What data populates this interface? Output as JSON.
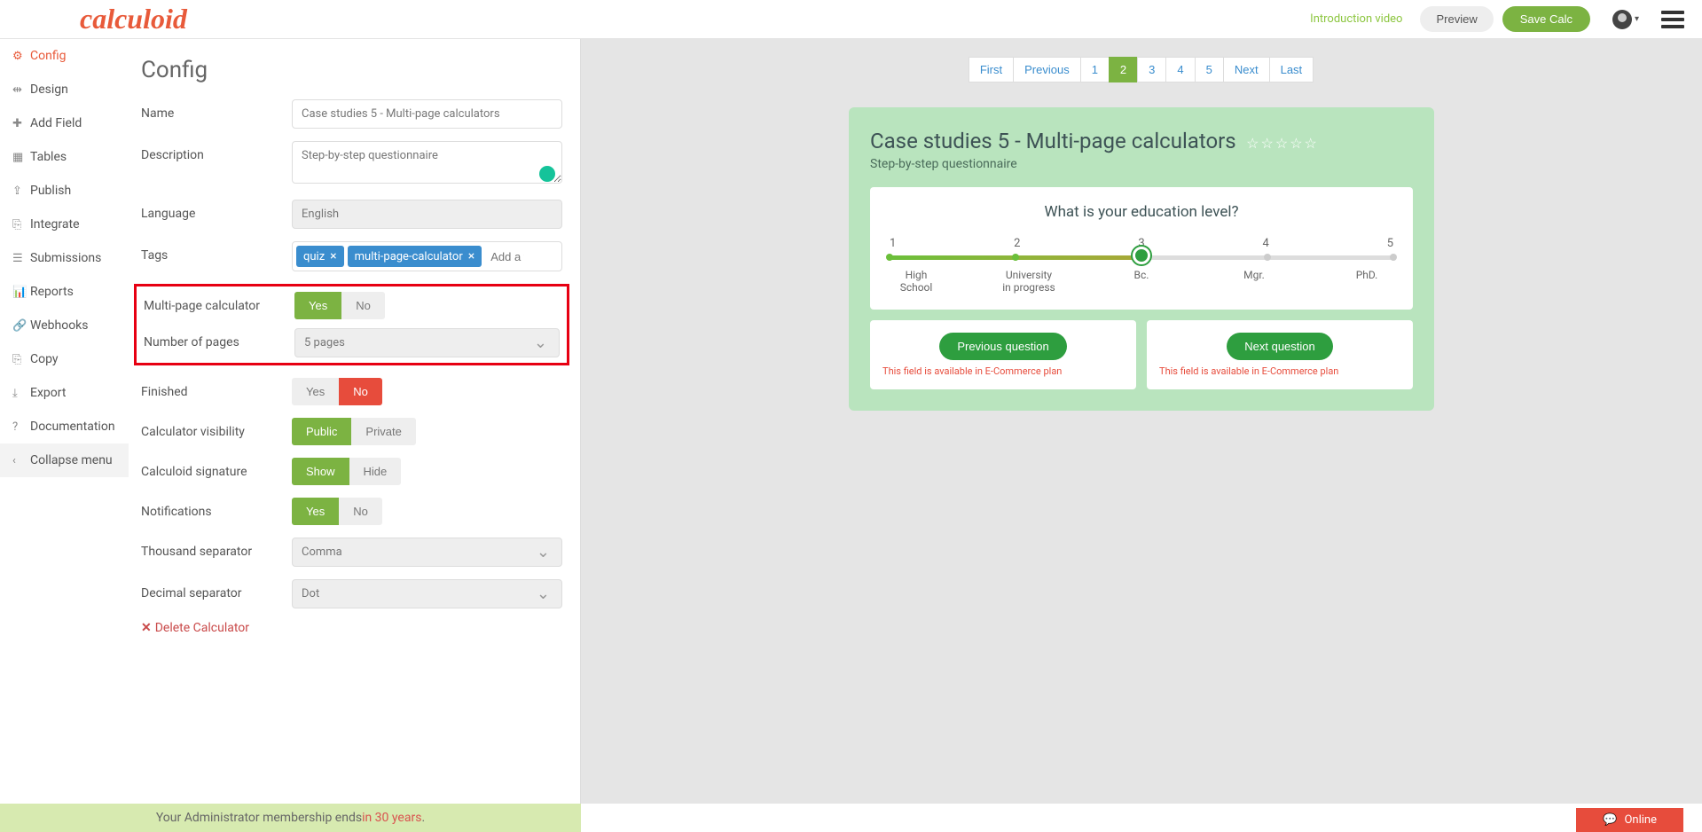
{
  "header": {
    "logo": "calculoid",
    "intro_link": "Introduction video",
    "preview": "Preview",
    "save": "Save Calc"
  },
  "sidebar": {
    "items": [
      {
        "label": "Config",
        "icon": "⚙"
      },
      {
        "label": "Design",
        "icon": "⇹"
      },
      {
        "label": "Add Field",
        "icon": "✚"
      },
      {
        "label": "Tables",
        "icon": "▦"
      },
      {
        "label": "Publish",
        "icon": "⇪"
      },
      {
        "label": "Integrate",
        "icon": "⎘"
      },
      {
        "label": "Submissions",
        "icon": "☰"
      },
      {
        "label": "Reports",
        "icon": "📊"
      },
      {
        "label": "Webhooks",
        "icon": "🔗"
      },
      {
        "label": "Copy",
        "icon": "⎘"
      },
      {
        "label": "Export",
        "icon": "⤓"
      },
      {
        "label": "Documentation",
        "icon": "?"
      },
      {
        "label": "Collapse menu",
        "icon": "‹"
      }
    ]
  },
  "config": {
    "title": "Config",
    "labels": {
      "name": "Name",
      "description": "Description",
      "language": "Language",
      "tags": "Tags",
      "multipage": "Multi-page calculator",
      "numpages": "Number of pages",
      "finished": "Finished",
      "visibility": "Calculator visibility",
      "signature": "Calculoid signature",
      "notifications": "Notifications",
      "thousand": "Thousand separator",
      "decimal": "Decimal separator"
    },
    "values": {
      "name": "Case studies 5 - Multi-page calculators",
      "description": "Step-by-step questionnaire",
      "language": "English",
      "tags": [
        "quiz",
        "multi-page-calculator"
      ],
      "tag_placeholder": "Add a ta",
      "numpages": "5 pages",
      "thousand": "Comma",
      "decimal": "Dot"
    },
    "toggles": {
      "yes": "Yes",
      "no": "No",
      "public": "Public",
      "private": "Private",
      "show": "Show",
      "hide": "Hide"
    },
    "delete": "Delete Calculator"
  },
  "preview": {
    "pagination": [
      "First",
      "Previous",
      "1",
      "2",
      "3",
      "4",
      "5",
      "Next",
      "Last"
    ],
    "active_page": "2",
    "calc_title": "Case studies 5 - Multi-page calculators",
    "calc_desc": "Step-by-step questionnaire",
    "question": "What is your education level?",
    "slider_numbers": [
      "1",
      "2",
      "3",
      "4",
      "5"
    ],
    "slider_labels": [
      "High School",
      "University in progress",
      "Bc.",
      "Mgr.",
      "PhD."
    ],
    "prev_btn": "Previous question",
    "next_btn": "Next question",
    "ecom_note": "This field is available in E-Commerce plan"
  },
  "footer": {
    "text": "Your Administrator membership ends ",
    "highlight": "in 30 years"
  },
  "online": "Online"
}
